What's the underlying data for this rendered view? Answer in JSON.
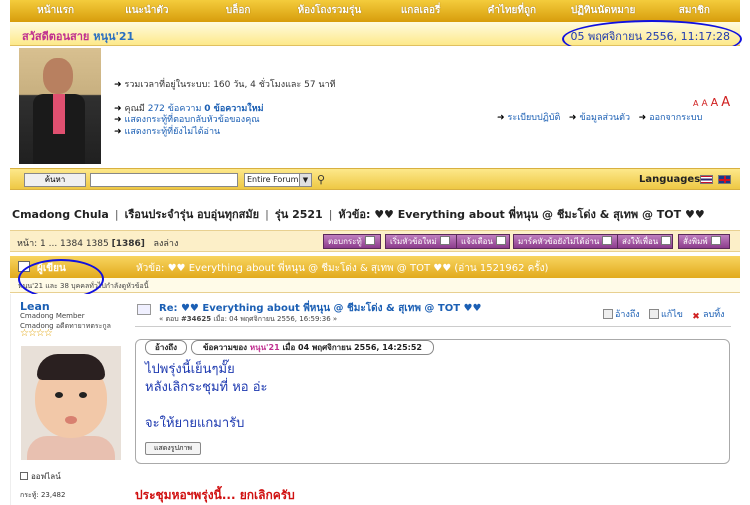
{
  "nav": [
    "หน้าแรก",
    "แนะนำตัว",
    "บล็อก",
    "ห้องโถงรวมรุ่น",
    "แกลเลอรี่",
    "คำไทยที่ถูก",
    "ปฏิทินนัดหมาย",
    "สมาชิก"
  ],
  "greeting": {
    "hello": "สวัสดีตอนสาย",
    "username": "หนุน'21",
    "datetime": "05 พฤศจิกายน 2556, 11:17:28"
  },
  "user": {
    "online_time": "รวมเวลาที่อยู่ในระบบ: 160 วัน, 4 ชั่วโมงและ 57 นาที",
    "you_have": "คุณมี",
    "messages_count": "272 ข้อความ",
    "new_count": "0 ข้อความใหม่",
    "replied_posts": "แสดงกระทู้ที่ตอบกลับหัวข้อของคุณ",
    "unread_posts": "แสดงกระทู้ที่ยังไม่ได้อ่าน",
    "links": [
      "ระเบียบปฏิบัติ",
      "ข้อมูลส่วนตัว",
      "ออกจากระบบ"
    ],
    "font_sizes": [
      "A",
      "A",
      "A",
      "A"
    ]
  },
  "search": {
    "button": "ค้นหา",
    "placeholder": "",
    "scope": "Entire Forum",
    "languages": "Languages"
  },
  "breadcrumb": [
    "Cmadong Chula",
    "เรือนประจำรุ่น อบอุ่นทุกสมัย",
    "รุ่น 2521",
    "หัวข้อ: ♥♥ Everything about พี่หนุน @ ชีมะโด่ง & สุเทพ @ TOT ♥♥"
  ],
  "pagination": {
    "prefix": "หน้า: 1 ... 1384 1385",
    "current": "[1386]",
    "bottom_link": "ลงล่าง"
  },
  "actions": [
    "ตอบกระทู้",
    "เริ่มหัวข้อใหม่",
    "แจ้งเตือน",
    "มาร์คหัวข้อยังไม่ได้อ่าน",
    "ส่งให้เพื่อน",
    "สั่งพิมพ์"
  ],
  "topic": {
    "author_col": "ผู้เขียน",
    "subject": "หัวข้อ: ♥♥ Everything about พี่หนุน @ ชีมะโด่ง & สุเทพ @ TOT ♥♥  (อ่าน 1521962 ครั้ง)",
    "viewers": "หนุน'21 และ 38 บุคคลทั่วไปกำลังดูหัวข้อนี้"
  },
  "post": {
    "poster_name": "Lean",
    "poster_group": "Cmadong Member",
    "poster_title": "Cmadong อดีตทายาทตระกูล",
    "stars": "☆☆☆☆",
    "status": "ออฟไลน์",
    "post_count": "กระทู้: 23,482",
    "subject": "Re: ♥♥ Everything about พี่หนุน @ ชีมะโด่ง & สุเทพ @ TOT ♥♥",
    "meta_prefix": "« ตอบ",
    "meta_num": "#34625",
    "meta_suffix": "เมื่อ: 04 พฤศจิกายน 2556, 16:59:36 »",
    "quote_label": "อ้างถึง",
    "edit_label": "แก้ไข",
    "delete_label": "ลบทิ้ง",
    "quote_tab": "อ้างถึง",
    "quote_header_pre": "ข้อความของ",
    "quote_header_name": "หนุน'21",
    "quote_header_post": "เมื่อ 04 พฤศจิกายน 2556, 14:25:52",
    "quote_lines": [
      "ไปพรุ่งนี้เย็นๆมั๊ย",
      "หลังเลิกระชุมที่ หอ อ่ะ",
      "จะให้ยายแกมารับ"
    ],
    "show_picture": "แสดงรูปภาพ",
    "reply_text": "ประชุมหอฯพรุ่งนี้... ยกเลิกครับ"
  }
}
